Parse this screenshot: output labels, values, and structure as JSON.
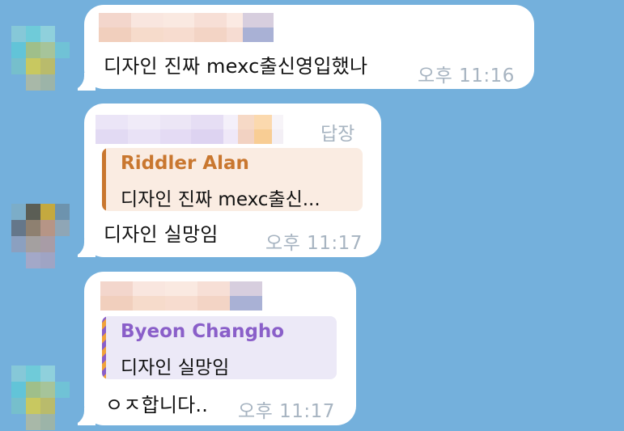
{
  "colors": {
    "background": "#74b0dc",
    "bubble": "#ffffff",
    "timestamp": "#a7b4c1",
    "quote1_bg": "#faece2",
    "quote1_accent": "#c9772f",
    "quote2_bg": "#ece9f7",
    "quote2_accent": "#8a5fc9"
  },
  "messages": [
    {
      "text": "디자인 진짜 mexc출신영입했나",
      "time": "오후 11:16"
    },
    {
      "reply_label": "답장",
      "quote_name": "Riddler Alan",
      "quote_text": "디자인 진짜 mexc출신...",
      "text": "디자인 실망임",
      "time": "오후 11:17"
    },
    {
      "quote_name": "Byeon Changho",
      "quote_text": "디자인 실망임",
      "text": "ㅇㅈ합니다..",
      "time": "오후 11:17"
    }
  ]
}
